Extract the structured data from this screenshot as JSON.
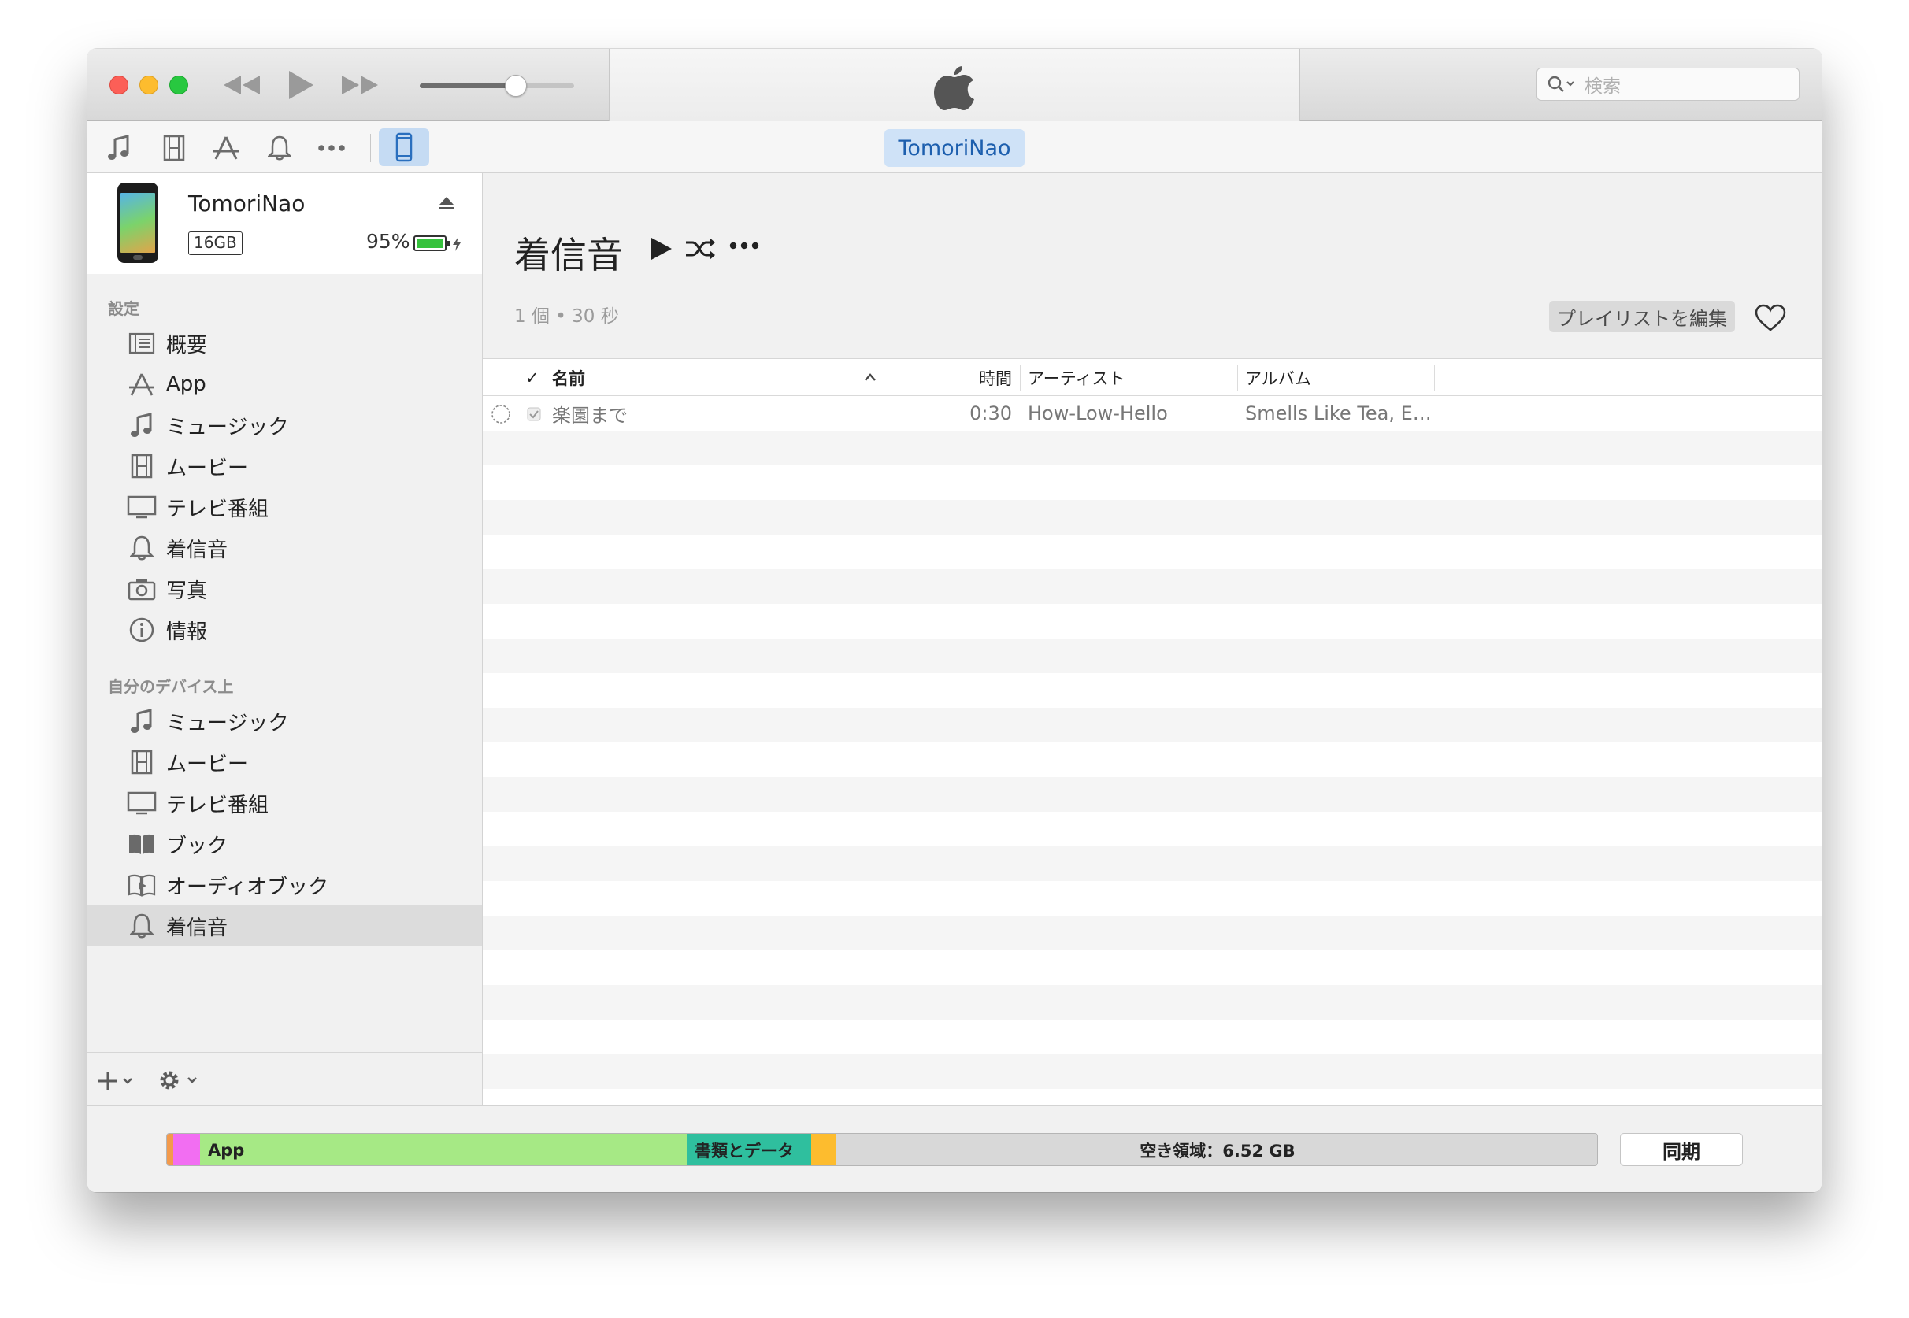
{
  "search": {
    "placeholder": "検索"
  },
  "toolbar": {
    "device_name": "TomoriNao"
  },
  "device": {
    "name": "TomoriNao",
    "capacity": "16GB",
    "battery_percent": "95%",
    "battery_level": 0.95
  },
  "sidebar": {
    "settings_header": "設定",
    "settings_items": [
      {
        "label": "概要",
        "icon": "summary-icon"
      },
      {
        "label": "App",
        "icon": "app-store-icon"
      },
      {
        "label": "ミュージック",
        "icon": "music-note-icon"
      },
      {
        "label": "ムービー",
        "icon": "film-icon"
      },
      {
        "label": "テレビ番組",
        "icon": "tv-icon"
      },
      {
        "label": "着信音",
        "icon": "bell-icon"
      },
      {
        "label": "写真",
        "icon": "camera-icon"
      },
      {
        "label": "情報",
        "icon": "info-icon"
      }
    ],
    "device_header": "自分のデバイス上",
    "device_items": [
      {
        "label": "ミュージック",
        "icon": "music-note-icon"
      },
      {
        "label": "ムービー",
        "icon": "film-icon"
      },
      {
        "label": "テレビ番組",
        "icon": "tv-icon"
      },
      {
        "label": "ブック",
        "icon": "book-icon"
      },
      {
        "label": "オーディオブック",
        "icon": "audiobook-icon"
      },
      {
        "label": "着信音",
        "icon": "bell-icon",
        "selected": true
      }
    ]
  },
  "playlist": {
    "title": "着信音",
    "meta": "1 個 • 30 秒",
    "edit_button": "プレイリストを編集"
  },
  "table": {
    "columns": {
      "check": "✓",
      "name": "名前",
      "time": "時間",
      "artist": "アーティスト",
      "album": "アルバム"
    },
    "rows": [
      {
        "name": "楽園まで",
        "time": "0:30",
        "artist": "How-Low-Hello",
        "album": "Smells Like Tea, E…"
      }
    ]
  },
  "storage": {
    "app_label": "App",
    "docs_label": "書類とデータ",
    "free_label": "空き領域：6.52 GB",
    "colors": {
      "orange": "#f39a4c",
      "pink": "#f26ef2",
      "app": "#a6e985",
      "docs": "#2fbf9e",
      "yellow": "#fdbc2e",
      "free": "#d8d8d8"
    }
  },
  "sync_button": "同期",
  "colors": {
    "accent": "#1d5fae",
    "device_pill": "#cfe2f7",
    "battery": "#36c23d"
  }
}
